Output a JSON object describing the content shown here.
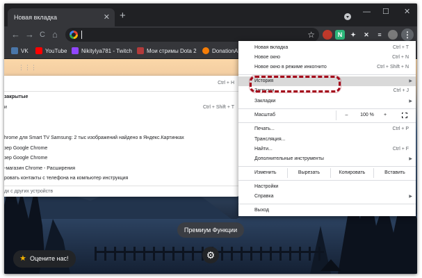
{
  "window": {
    "tab_title": "Новая вкладка",
    "tab_close": "✕",
    "new_tab": "+",
    "minimize": "—",
    "maximize": "☐",
    "close": "✕"
  },
  "toolbar": {
    "back": "←",
    "forward": "→",
    "reload": "C",
    "home": "⌂",
    "bookmark_star": "☆",
    "menu_dots": "⋮",
    "extensions": [
      {
        "name": "extension-red",
        "glyph": "",
        "color": "#c0392b"
      },
      {
        "name": "extension-n",
        "glyph": "N",
        "color": "#2db77a"
      },
      {
        "name": "extension-puzzle",
        "glyph": "✦",
        "color": "#35363a"
      },
      {
        "name": "extension-pin",
        "glyph": "✕",
        "color": "#35363a"
      },
      {
        "name": "extension-list",
        "glyph": "≡",
        "color": "#35363a"
      }
    ]
  },
  "bookmarks": {
    "items": [
      {
        "label": "VK",
        "color": "#4a76a8"
      },
      {
        "label": "YouTube",
        "color": "#ff0000"
      },
      {
        "label": "Nikitylya781 - Twitch",
        "color": "#9146ff"
      },
      {
        "label": "Мои стримы Dota 2",
        "color": "#b23b3b"
      },
      {
        "label": "DonationAl",
        "color": "#f57d07"
      }
    ]
  },
  "history_panel": {
    "history_shortcut": "Ctrl + H",
    "recently_closed_header": "закрытые",
    "window_item": "и",
    "window_shortcut": "Ctrl + Shift + T",
    "entries": [
      "hrome для Smart TV Samsung: 2 тыс изображений найдено в Яндекс.Картинках",
      "зер Google Chrome",
      "зер Google Chrome",
      "-магазин Chrome - Расширения",
      "ровать контакты с телефона на компьютер инструкция"
    ],
    "other_devices": "дк с других устройств"
  },
  "menu": {
    "new_tab": {
      "label": "Новая вкладка",
      "shortcut": "Ctrl + T"
    },
    "new_window": {
      "label": "Новое окно",
      "shortcut": "Ctrl + N"
    },
    "incognito": {
      "label": "Новое окно в режиме инкогнито",
      "shortcut": "Ctrl + Shift + N"
    },
    "history": {
      "label": "История",
      "arrow": "▶"
    },
    "downloads": {
      "label": "Загрузки",
      "shortcut": "Ctrl + J"
    },
    "bookmarks": {
      "label": "Закладки",
      "arrow": "▶"
    },
    "zoom": {
      "label": "Масштаб",
      "minus": "–",
      "value": "100 %",
      "plus": "+"
    },
    "print": {
      "label": "Печать...",
      "shortcut": "Ctrl + P"
    },
    "cast": {
      "label": "Трансляция..."
    },
    "find": {
      "label": "Найти...",
      "shortcut": "Ctrl + F"
    },
    "more_tools": {
      "label": "Дополнительные инструменты",
      "arrow": "▶"
    },
    "edit": {
      "label": "Изменить",
      "cut": "Вырезать",
      "copy": "Копировать",
      "paste": "Вставить"
    },
    "settings": {
      "label": "Настройки"
    },
    "help": {
      "label": "Справка",
      "arrow": "▶"
    },
    "exit": {
      "label": "Выход"
    }
  },
  "page": {
    "premium_button": "Премиум Функции",
    "rate_button": "Оцените нас!",
    "rate_star": "★",
    "settings_gear": "⚙",
    "apps_icon": "⋮⋮⋮"
  },
  "colors": {
    "highlight": "#a3081a",
    "titlebar": "#202124",
    "toolbar": "#35363a"
  }
}
